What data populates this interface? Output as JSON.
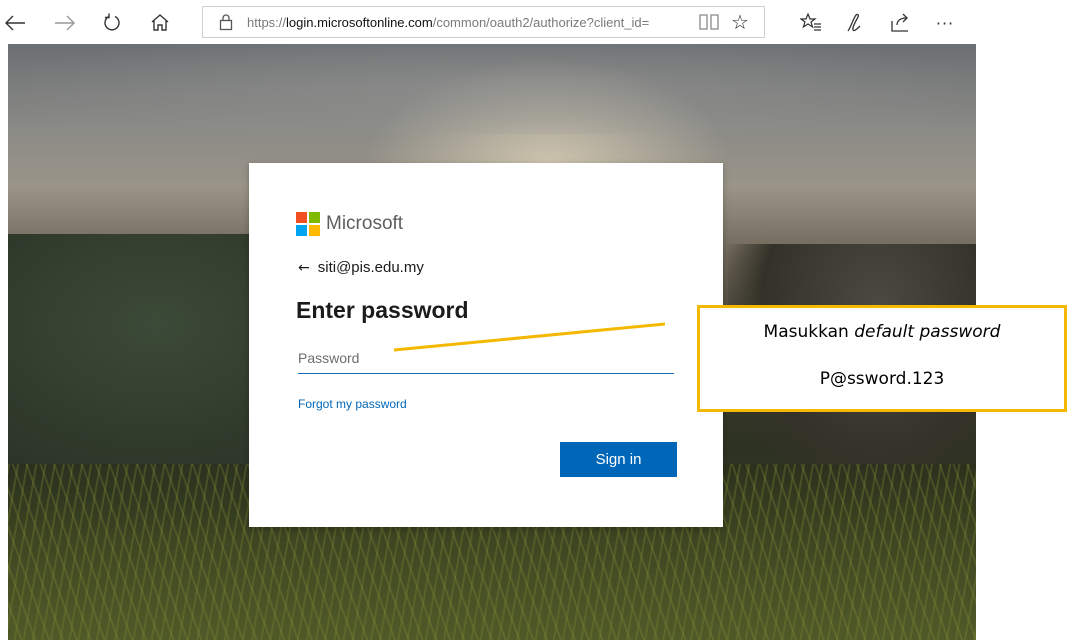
{
  "browser": {
    "url_prefix": "https://",
    "url_host": "login.microsoftonline.com",
    "url_path": "/common/oauth2/authorize?client_id=",
    "icons": [
      "back-icon",
      "forward-icon",
      "refresh-icon",
      "home-icon",
      "lock-icon",
      "reading-view-icon",
      "favorite-star-icon",
      "favorites-list-icon",
      "pen-icon",
      "share-icon",
      "more-icon"
    ],
    "more_label": "···"
  },
  "signin": {
    "brand": "Microsoft",
    "brand_colors": [
      "#f25022",
      "#7fba00",
      "#00a4ef",
      "#ffb900"
    ],
    "identity": "siti@pis.edu.my",
    "back_symbol": "←",
    "heading": "Enter password",
    "password_placeholder": "Password",
    "forgot_label": "Forgot my password",
    "submit_label": "Sign in",
    "accent_color": "#0067b8"
  },
  "annotation": {
    "line1_prefix": "Masukkan ",
    "line1_emphasis": "default password",
    "line2": "P@ssword.123",
    "border_color": "#f5b800"
  }
}
